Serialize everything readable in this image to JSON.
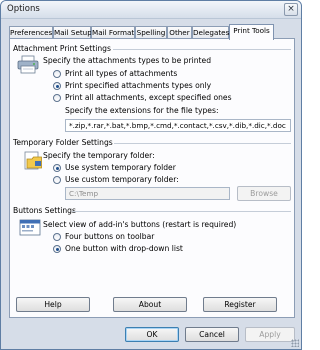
{
  "window": {
    "title": "Options",
    "close_glyph": "×"
  },
  "tabs": [
    {
      "label": "Preferences",
      "active": false
    },
    {
      "label": "Mail Setup",
      "active": false
    },
    {
      "label": "Mail Format",
      "active": false
    },
    {
      "label": "Spelling",
      "active": false
    },
    {
      "label": "Other",
      "active": false
    },
    {
      "label": "Delegates",
      "active": false
    },
    {
      "label": "Print Tools",
      "active": true
    }
  ],
  "attachment": {
    "section_title": "Attachment Print Settings",
    "prompt": "Specify the attachments types to be printed",
    "options": [
      {
        "label": "Print all types of attachments",
        "selected": false
      },
      {
        "label": "Print specified attachments types only",
        "selected": true
      },
      {
        "label": "Print all attachments, except specified ones",
        "selected": false
      }
    ],
    "extensions_prompt": "Specify the extensions for the file types:",
    "extensions_value": "*.zip,*.rar,*.bat,*.bmp,*.cmd,*.contact,*.csv,*.dib,*.dic,*.doc"
  },
  "temp": {
    "section_title": "Temporary Folder Settings",
    "prompt": "Specify the temporary folder:",
    "options": [
      {
        "label": "Use system temporary folder",
        "selected": true
      },
      {
        "label": "Use custom temporary folder:",
        "selected": false
      }
    ],
    "path_value": "C:\\Temp",
    "browse_label": "Browse"
  },
  "buttons_settings": {
    "section_title": "Buttons Settings",
    "prompt": "Select view of add-in's buttons (restart is required)",
    "options": [
      {
        "label": "Four buttons on toolbar",
        "selected": false
      },
      {
        "label": "One button with drop-down list",
        "selected": true
      }
    ]
  },
  "panel_buttons": {
    "help": "Help",
    "about": "About",
    "register": "Register"
  },
  "dialog_buttons": {
    "ok": "OK",
    "cancel": "Cancel",
    "apply": "Apply"
  },
  "colors": {
    "accent": "#3c7fb1",
    "window_bg": "#d6dde8",
    "panel_bg": "#fcfcfe"
  }
}
